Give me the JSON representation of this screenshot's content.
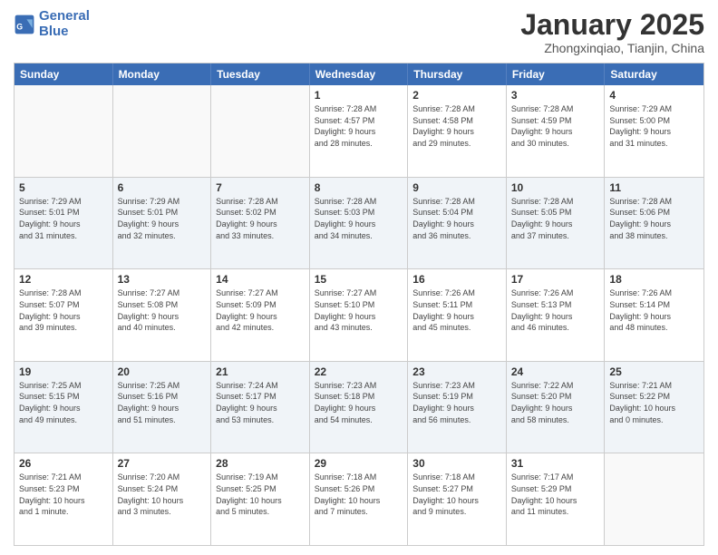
{
  "header": {
    "logo_line1": "General",
    "logo_line2": "Blue",
    "month": "January 2025",
    "location": "Zhongxinqiao, Tianjin, China"
  },
  "day_headers": [
    "Sunday",
    "Monday",
    "Tuesday",
    "Wednesday",
    "Thursday",
    "Friday",
    "Saturday"
  ],
  "weeks": [
    [
      {
        "date": "",
        "info": ""
      },
      {
        "date": "",
        "info": ""
      },
      {
        "date": "",
        "info": ""
      },
      {
        "date": "1",
        "info": "Sunrise: 7:28 AM\nSunset: 4:57 PM\nDaylight: 9 hours\nand 28 minutes."
      },
      {
        "date": "2",
        "info": "Sunrise: 7:28 AM\nSunset: 4:58 PM\nDaylight: 9 hours\nand 29 minutes."
      },
      {
        "date": "3",
        "info": "Sunrise: 7:28 AM\nSunset: 4:59 PM\nDaylight: 9 hours\nand 30 minutes."
      },
      {
        "date": "4",
        "info": "Sunrise: 7:29 AM\nSunset: 5:00 PM\nDaylight: 9 hours\nand 31 minutes."
      }
    ],
    [
      {
        "date": "5",
        "info": "Sunrise: 7:29 AM\nSunset: 5:01 PM\nDaylight: 9 hours\nand 31 minutes."
      },
      {
        "date": "6",
        "info": "Sunrise: 7:29 AM\nSunset: 5:01 PM\nDaylight: 9 hours\nand 32 minutes."
      },
      {
        "date": "7",
        "info": "Sunrise: 7:28 AM\nSunset: 5:02 PM\nDaylight: 9 hours\nand 33 minutes."
      },
      {
        "date": "8",
        "info": "Sunrise: 7:28 AM\nSunset: 5:03 PM\nDaylight: 9 hours\nand 34 minutes."
      },
      {
        "date": "9",
        "info": "Sunrise: 7:28 AM\nSunset: 5:04 PM\nDaylight: 9 hours\nand 36 minutes."
      },
      {
        "date": "10",
        "info": "Sunrise: 7:28 AM\nSunset: 5:05 PM\nDaylight: 9 hours\nand 37 minutes."
      },
      {
        "date": "11",
        "info": "Sunrise: 7:28 AM\nSunset: 5:06 PM\nDaylight: 9 hours\nand 38 minutes."
      }
    ],
    [
      {
        "date": "12",
        "info": "Sunrise: 7:28 AM\nSunset: 5:07 PM\nDaylight: 9 hours\nand 39 minutes."
      },
      {
        "date": "13",
        "info": "Sunrise: 7:27 AM\nSunset: 5:08 PM\nDaylight: 9 hours\nand 40 minutes."
      },
      {
        "date": "14",
        "info": "Sunrise: 7:27 AM\nSunset: 5:09 PM\nDaylight: 9 hours\nand 42 minutes."
      },
      {
        "date": "15",
        "info": "Sunrise: 7:27 AM\nSunset: 5:10 PM\nDaylight: 9 hours\nand 43 minutes."
      },
      {
        "date": "16",
        "info": "Sunrise: 7:26 AM\nSunset: 5:11 PM\nDaylight: 9 hours\nand 45 minutes."
      },
      {
        "date": "17",
        "info": "Sunrise: 7:26 AM\nSunset: 5:13 PM\nDaylight: 9 hours\nand 46 minutes."
      },
      {
        "date": "18",
        "info": "Sunrise: 7:26 AM\nSunset: 5:14 PM\nDaylight: 9 hours\nand 48 minutes."
      }
    ],
    [
      {
        "date": "19",
        "info": "Sunrise: 7:25 AM\nSunset: 5:15 PM\nDaylight: 9 hours\nand 49 minutes."
      },
      {
        "date": "20",
        "info": "Sunrise: 7:25 AM\nSunset: 5:16 PM\nDaylight: 9 hours\nand 51 minutes."
      },
      {
        "date": "21",
        "info": "Sunrise: 7:24 AM\nSunset: 5:17 PM\nDaylight: 9 hours\nand 53 minutes."
      },
      {
        "date": "22",
        "info": "Sunrise: 7:23 AM\nSunset: 5:18 PM\nDaylight: 9 hours\nand 54 minutes."
      },
      {
        "date": "23",
        "info": "Sunrise: 7:23 AM\nSunset: 5:19 PM\nDaylight: 9 hours\nand 56 minutes."
      },
      {
        "date": "24",
        "info": "Sunrise: 7:22 AM\nSunset: 5:20 PM\nDaylight: 9 hours\nand 58 minutes."
      },
      {
        "date": "25",
        "info": "Sunrise: 7:21 AM\nSunset: 5:22 PM\nDaylight: 10 hours\nand 0 minutes."
      }
    ],
    [
      {
        "date": "26",
        "info": "Sunrise: 7:21 AM\nSunset: 5:23 PM\nDaylight: 10 hours\nand 1 minute."
      },
      {
        "date": "27",
        "info": "Sunrise: 7:20 AM\nSunset: 5:24 PM\nDaylight: 10 hours\nand 3 minutes."
      },
      {
        "date": "28",
        "info": "Sunrise: 7:19 AM\nSunset: 5:25 PM\nDaylight: 10 hours\nand 5 minutes."
      },
      {
        "date": "29",
        "info": "Sunrise: 7:18 AM\nSunset: 5:26 PM\nDaylight: 10 hours\nand 7 minutes."
      },
      {
        "date": "30",
        "info": "Sunrise: 7:18 AM\nSunset: 5:27 PM\nDaylight: 10 hours\nand 9 minutes."
      },
      {
        "date": "31",
        "info": "Sunrise: 7:17 AM\nSunset: 5:29 PM\nDaylight: 10 hours\nand 11 minutes."
      },
      {
        "date": "",
        "info": ""
      }
    ]
  ]
}
